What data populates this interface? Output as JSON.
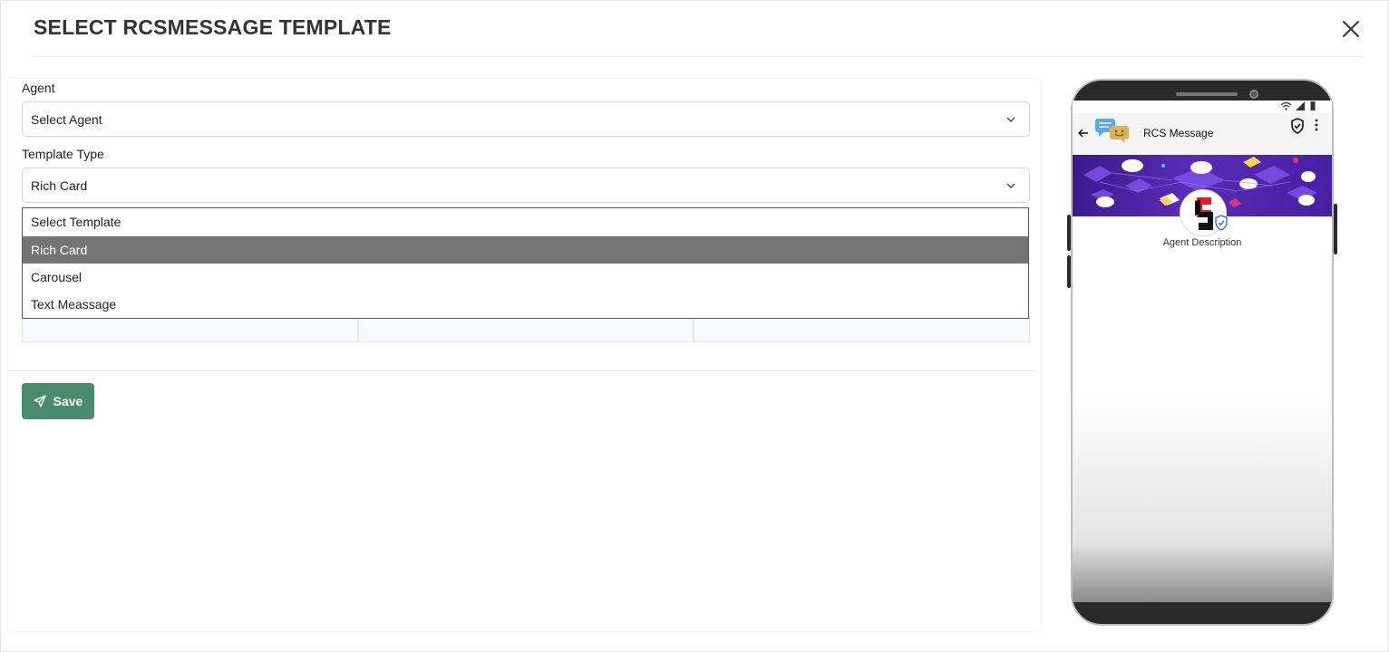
{
  "modal": {
    "title": "SELECT RCSMESSAGE TEMPLATE",
    "close_icon": "close-icon"
  },
  "form": {
    "agent": {
      "label": "Agent",
      "value": "Select Agent"
    },
    "template_type": {
      "label": "Template Type",
      "value": "Rich Card",
      "options": [
        {
          "label": "Select Template",
          "selected": false
        },
        {
          "label": "Rich Card",
          "selected": true
        },
        {
          "label": "Carousel",
          "selected": false
        },
        {
          "label": "Text Meassage",
          "selected": false
        }
      ]
    },
    "save_button": {
      "label": "Save",
      "icon": "send-icon",
      "color": "#4a8b6e"
    }
  },
  "preview": {
    "app_title": "RCS Message",
    "agent_description": "Agent Description",
    "icons": [
      "back-arrow-icon",
      "chat-bubbles-icon",
      "shield-check-icon",
      "more-vertical-icon",
      "wifi-icon",
      "signal-icon",
      "battery-icon",
      "verified-badge-icon"
    ],
    "banner_color": "#4b22a6"
  }
}
